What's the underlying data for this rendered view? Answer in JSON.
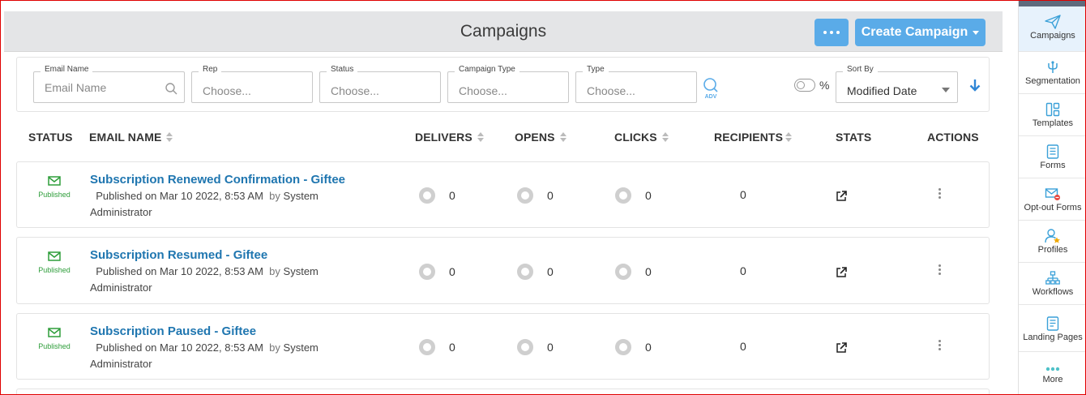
{
  "header": {
    "title": "Campaigns",
    "create_label": "Create Campaign"
  },
  "filters": {
    "email_name": {
      "label": "Email Name",
      "placeholder": "Email Name"
    },
    "rep": {
      "label": "Rep",
      "value": "Choose..."
    },
    "status": {
      "label": "Status",
      "value": "Choose..."
    },
    "campaign_type": {
      "label": "Campaign Type",
      "value": "Choose..."
    },
    "type": {
      "label": "Type",
      "value": "Choose..."
    },
    "adv_label": "ADV",
    "percent_label": "%",
    "sort_by": {
      "label": "Sort By",
      "value": "Modified Date"
    }
  },
  "table": {
    "columns": {
      "status": "STATUS",
      "email_name": "EMAIL NAME",
      "delivers": "DELIVERS",
      "opens": "OPENS",
      "clicks": "CLICKS",
      "recipients": "RECIPIENTS",
      "stats": "STATS",
      "actions": "ACTIONS"
    },
    "rows": [
      {
        "status": "Published",
        "name": "Subscription Renewed Confirmation - Giftee",
        "published": "Published on Mar 10 2022, 8:53 AM",
        "by": "by",
        "author_first": "System",
        "author_rest": "Administrator",
        "delivers": "0",
        "opens": "0",
        "clicks": "0",
        "recipients": "0"
      },
      {
        "status": "Published",
        "name": "Subscription Resumed - Giftee",
        "published": "Published on Mar 10 2022, 8:53 AM",
        "by": "by",
        "author_first": "System",
        "author_rest": "Administrator",
        "delivers": "0",
        "opens": "0",
        "clicks": "0",
        "recipients": "0"
      },
      {
        "status": "Published",
        "name": "Subscription Paused - Giftee",
        "published": "Published on Mar 10 2022, 8:53 AM",
        "by": "by",
        "author_first": "System",
        "author_rest": "Administrator",
        "delivers": "0",
        "opens": "0",
        "clicks": "0",
        "recipients": "0"
      }
    ]
  },
  "sidebar": {
    "items": [
      {
        "label": "Campaigns",
        "icon": "paper-plane-icon"
      },
      {
        "label": "Segmentation",
        "icon": "fork-icon"
      },
      {
        "label": "Templates",
        "icon": "layout-icon"
      },
      {
        "label": "Forms",
        "icon": "form-icon"
      },
      {
        "label": "Opt-out Forms",
        "icon": "mail-block-icon"
      },
      {
        "label": "Profiles",
        "icon": "user-star-icon"
      },
      {
        "label": "Workflows",
        "icon": "hierarchy-icon"
      },
      {
        "label": "Landing Pages",
        "icon": "page-icon"
      },
      {
        "label": "More",
        "icon": "dots-icon"
      }
    ]
  },
  "colors": {
    "accent": "#5aabe8",
    "link": "#1f76b0",
    "published": "#2e9d3a",
    "header_bg": "#e4e5e7",
    "sidebar_active": "#e7f2fc"
  }
}
